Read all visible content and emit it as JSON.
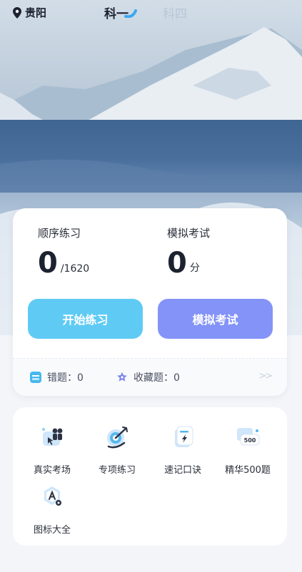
{
  "topbar": {
    "location": "贵阳",
    "tabs": [
      {
        "label": "科一",
        "active": true
      },
      {
        "label": "科四",
        "active": false
      }
    ]
  },
  "stats": {
    "sequential": {
      "title": "顺序练习",
      "value": "0",
      "unit": "/1620"
    },
    "mock": {
      "title": "模拟考试",
      "value": "0",
      "unit": "分"
    }
  },
  "buttons": {
    "start_label": "开始练习",
    "exam_label": "模拟考试"
  },
  "footer": {
    "wrong_label": "错题：0",
    "fav_label": "收藏题：0",
    "more_icon": ">>"
  },
  "grid": [
    {
      "label": "真实考场",
      "icon": "exam-room-icon"
    },
    {
      "label": "专项练习",
      "icon": "target-icon"
    },
    {
      "label": "速记口诀",
      "icon": "memo-icon"
    },
    {
      "label": "精华500题",
      "icon": "badge-500-icon",
      "badge": "500"
    },
    {
      "label": "图标大全",
      "icon": "icon-library-icon"
    }
  ],
  "colors": {
    "start_button": "#5fcbf5",
    "exam_button": "#8393f7",
    "inactive_tab": "#b9c6d8"
  }
}
